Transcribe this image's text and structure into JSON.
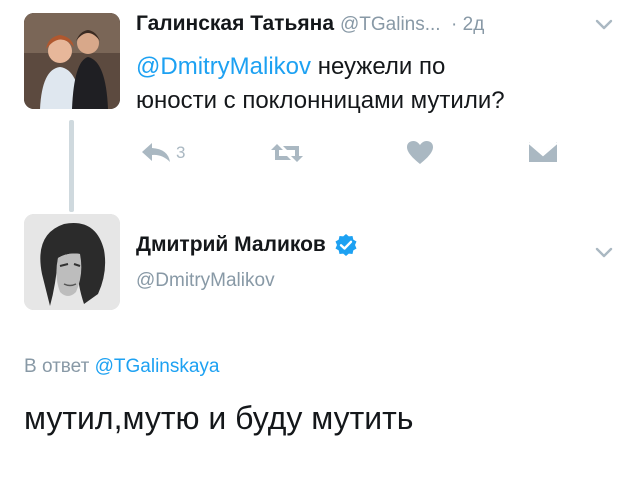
{
  "tweet1": {
    "name": "Галинская Татьяна",
    "handle": "@TGalins...",
    "time": "· 2д",
    "mention": "@DmitryMalikov",
    "text_line1": "неужели по",
    "text_line2": "юности с поклонницами мутили?",
    "reply_count": "3",
    "icons": {
      "reply": "reply-icon",
      "retweet": "retweet-icon",
      "like": "heart-icon",
      "dm": "envelope-icon",
      "menu": "chevron-down-icon"
    }
  },
  "tweet2": {
    "name": "Дмитрий Маликов",
    "handle": "@DmitryMalikov",
    "reply_prefix": "В ответ",
    "reply_to": "@TGalinskaya",
    "text": "мутил,мутю и буду мутить",
    "icons": {
      "verified": "verified-badge-icon",
      "menu": "chevron-down-icon"
    }
  },
  "colors": {
    "link": "#1da1f2",
    "muted": "#8899a6",
    "icon": "#aab8c2",
    "text": "#14171a"
  }
}
